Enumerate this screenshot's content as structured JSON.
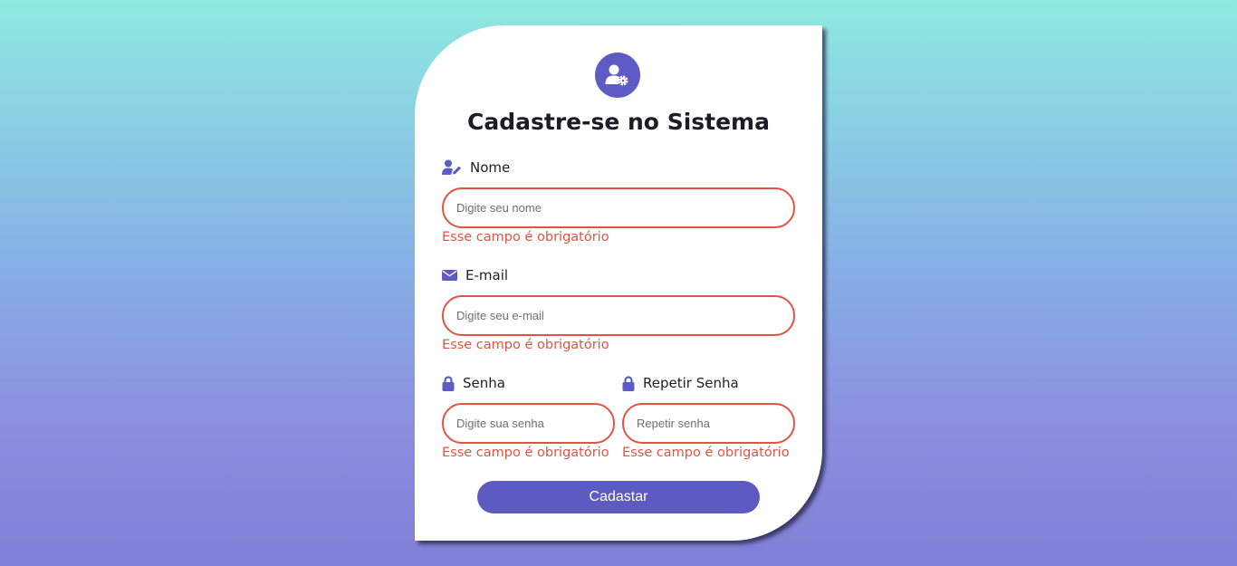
{
  "form": {
    "title": "Cadastre-se no Sistema",
    "header_icon": "user-gear-icon",
    "accent_color": "#5e5bc5",
    "error_color": "#e25343",
    "fields": {
      "name": {
        "icon": "user-pen-icon",
        "label": "Nome",
        "placeholder": "Digite seu nome",
        "value": "",
        "error": "Esse campo é obrigatório"
      },
      "email": {
        "icon": "envelope-icon",
        "label": "E-mail",
        "placeholder": "Digite seu e-mail",
        "value": "",
        "error": "Esse campo é obrigatório"
      },
      "password": {
        "icon": "lock-icon",
        "label": "Senha",
        "placeholder": "Digite sua senha",
        "value": "",
        "error": "Esse campo é obrigatório"
      },
      "password_repeat": {
        "icon": "lock-icon",
        "label": "Repetir Senha",
        "placeholder": "Repetir senha",
        "value": "",
        "error": "Esse campo é obrigatório"
      }
    },
    "submit_label": "Cadastar"
  }
}
